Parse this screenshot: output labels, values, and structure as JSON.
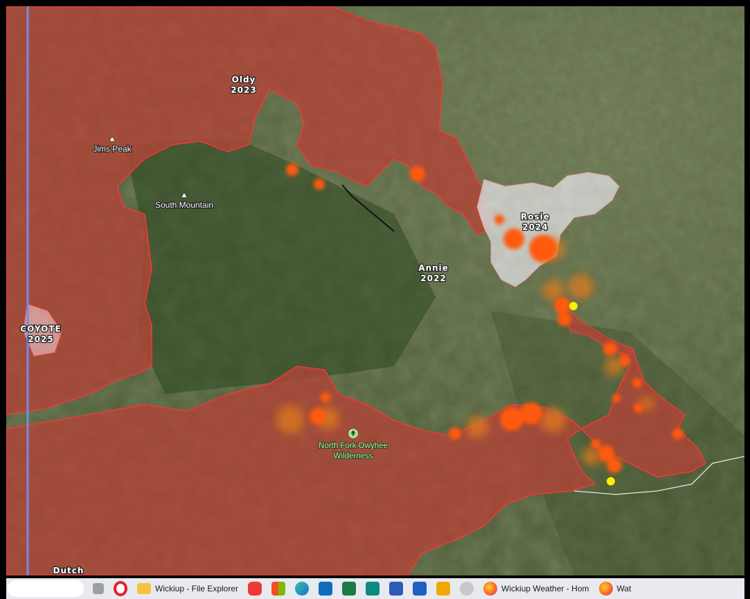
{
  "map": {
    "fire_perimeters": [
      {
        "name": "Oldy",
        "year": "2023"
      },
      {
        "name": "Rosie",
        "year": "2024"
      },
      {
        "name": "Annie",
        "year": "2022"
      },
      {
        "name": "COYOTE",
        "year": "2025"
      }
    ],
    "peaks": [
      {
        "name": "Jims Peak"
      },
      {
        "name": "South Mountain"
      }
    ],
    "wilderness": {
      "line1": "North Fork Owyhee",
      "line2": "Wilderness"
    },
    "places": [
      {
        "name": "Dutch"
      }
    ],
    "colors": {
      "perimeter_fill": "#b5483a",
      "perimeter_stroke": "#ff3a3a",
      "rosie_fill": "#d9dede",
      "hotspot": "#ff5a10",
      "hotspot_old": "#e07a1f",
      "point_marker": "#ffee00",
      "meridian_line": "#6f8fe8"
    }
  },
  "taskbar": {
    "items": [
      {
        "icon": "windows-icon"
      },
      {
        "icon": "opera-icon"
      },
      {
        "icon": "folder-icon",
        "label": "Wickiup - File Explorer"
      },
      {
        "icon": "vivaldi-icon"
      },
      {
        "icon": "store-icon"
      },
      {
        "icon": "edge-icon"
      },
      {
        "icon": "outlook-icon"
      },
      {
        "icon": "excel-icon"
      },
      {
        "icon": "publisher-icon"
      },
      {
        "icon": "visio-icon"
      },
      {
        "icon": "word-icon"
      },
      {
        "icon": "media-icon"
      },
      {
        "icon": "tool-icon"
      },
      {
        "icon": "firefox-icon",
        "label": "Wickiup Weather - Hom"
      },
      {
        "icon": "firefox-icon",
        "label": "Wat"
      }
    ]
  }
}
